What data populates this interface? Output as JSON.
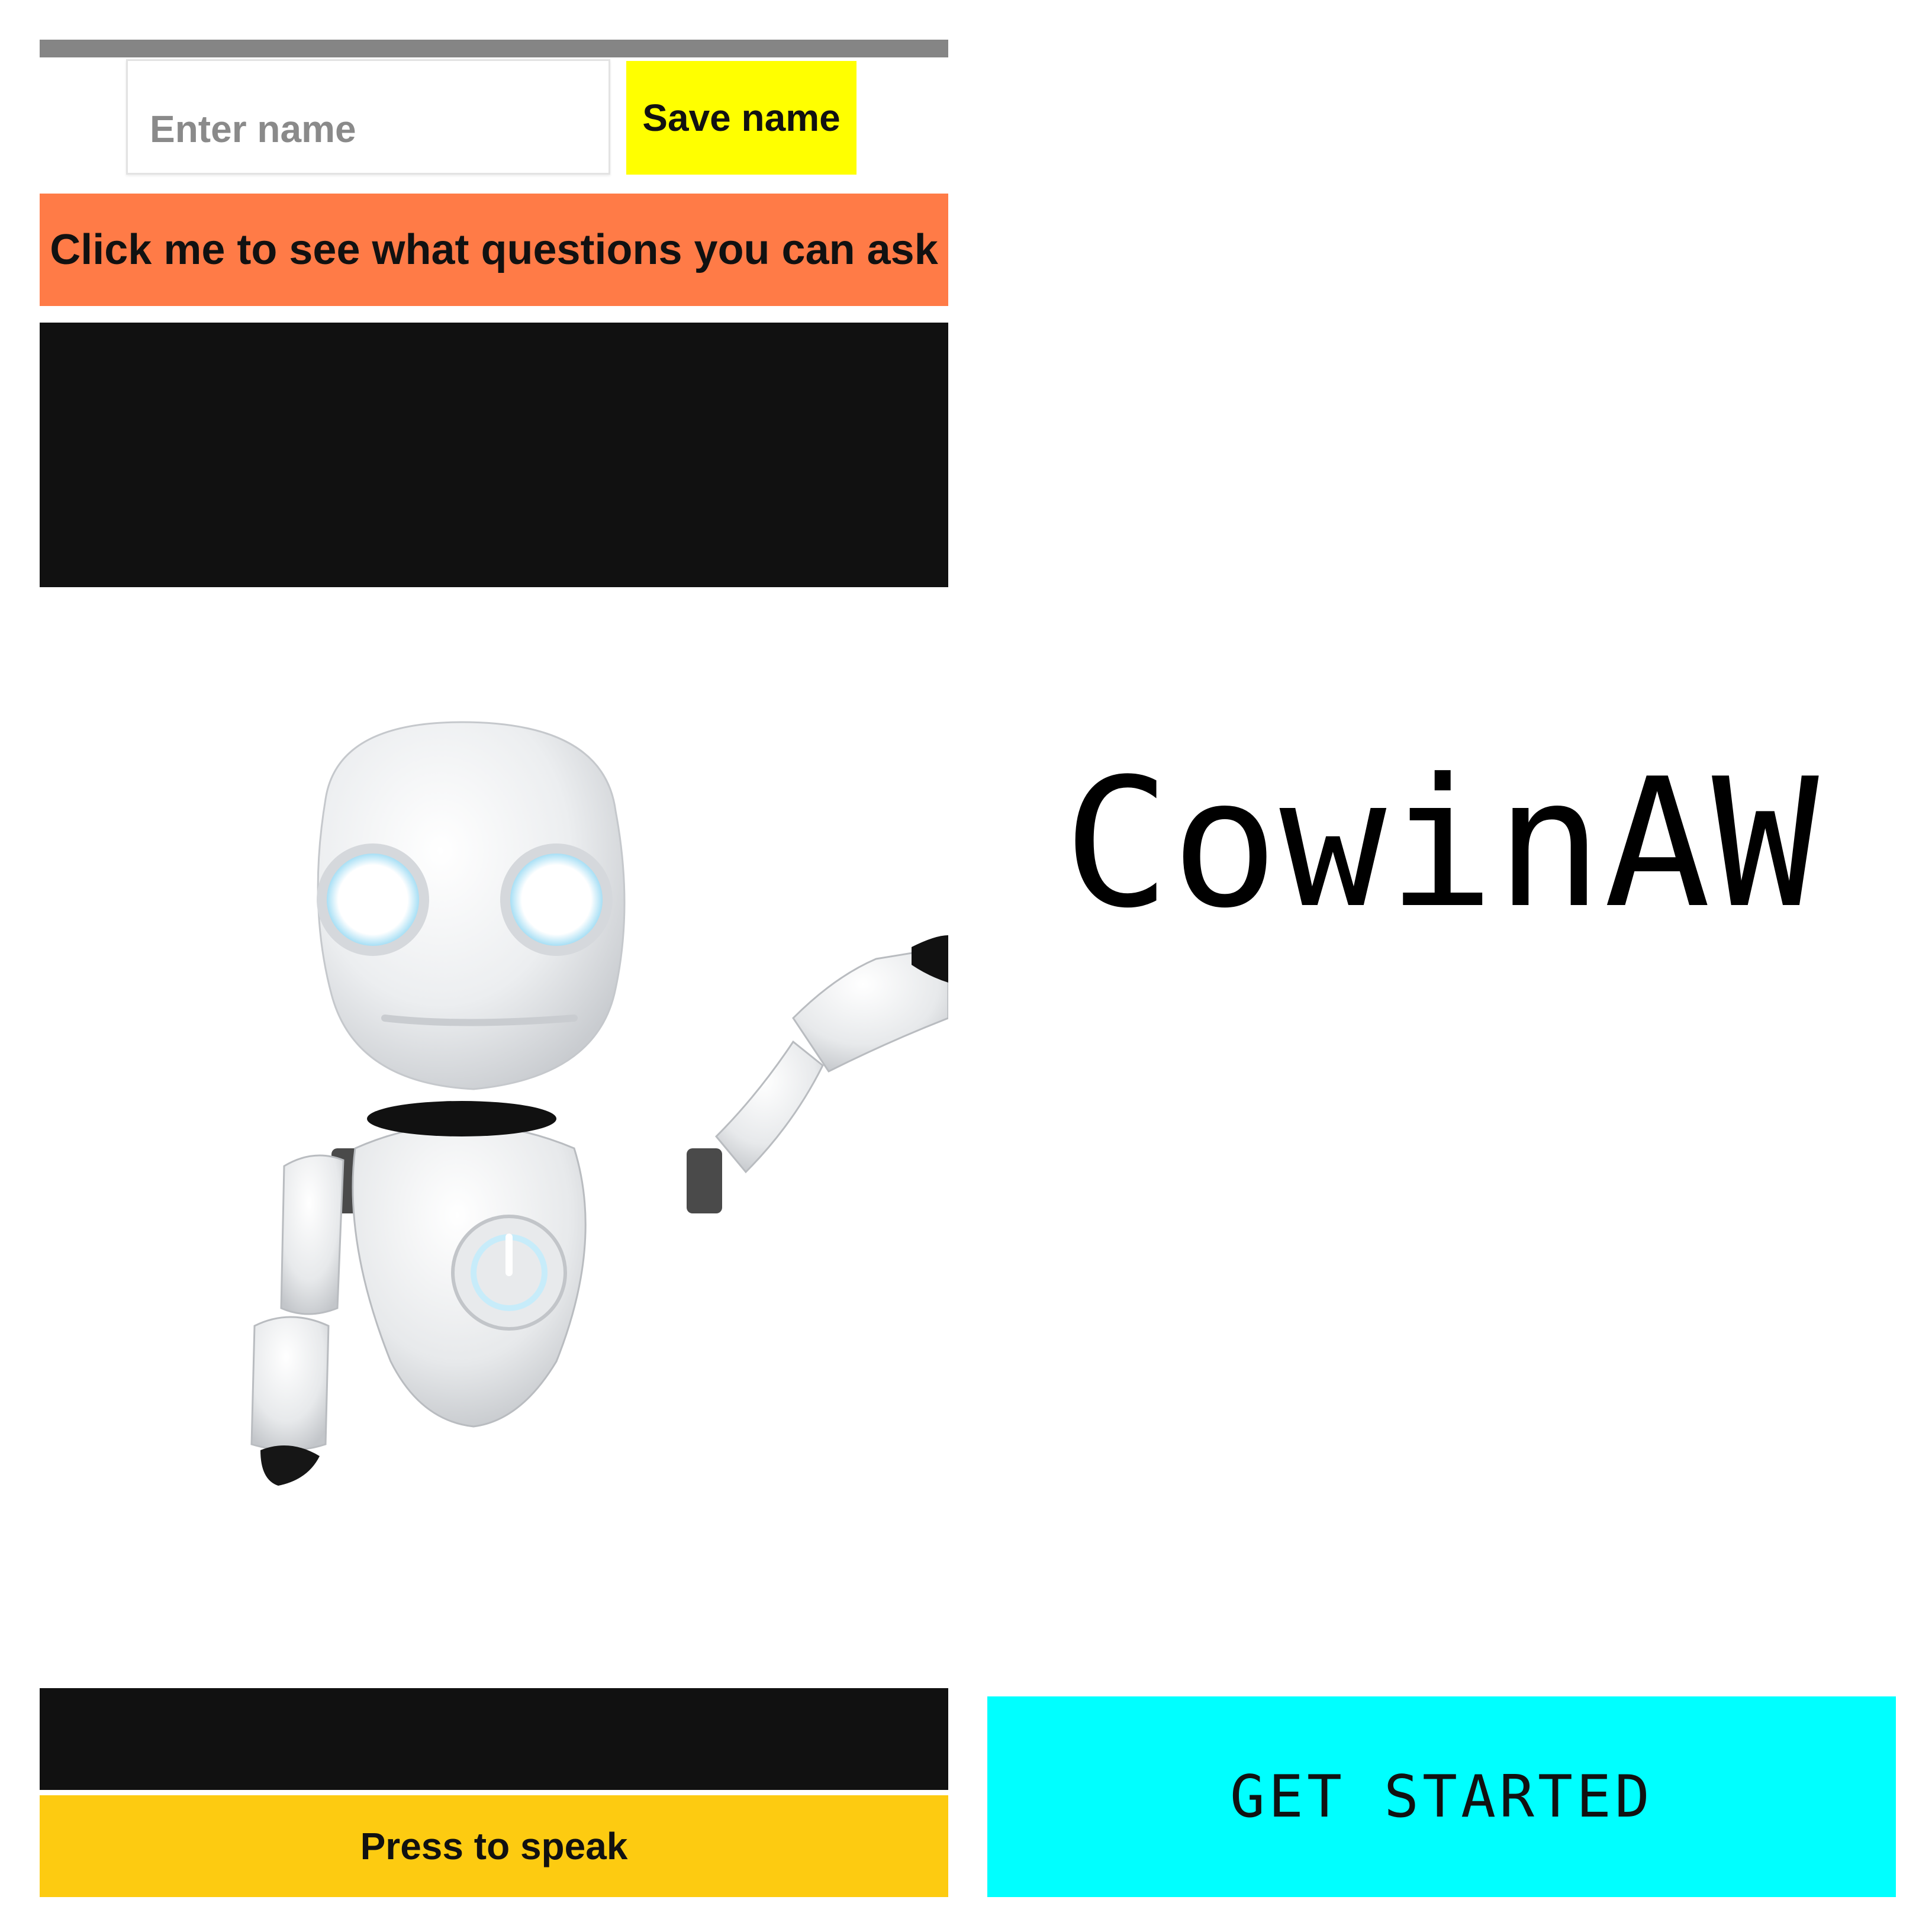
{
  "left_screen": {
    "name_input": {
      "placeholder": "Enter name",
      "value": ""
    },
    "save_button_label": "Save name",
    "questions_button_label": "Click me to see what questions you can ask",
    "speak_button_label": "Press to speak",
    "colors": {
      "top_bar": "#858585",
      "save_button": "#ffff00",
      "questions_button": "#ff7b47",
      "black_panel": "#111111",
      "speak_button": "#fdcb11"
    },
    "image": "robot-mascot-waving"
  },
  "right_screen": {
    "app_title": "CowinAW",
    "get_started_label": "GET STARTED",
    "colors": {
      "get_started_button": "#00ffff"
    }
  }
}
